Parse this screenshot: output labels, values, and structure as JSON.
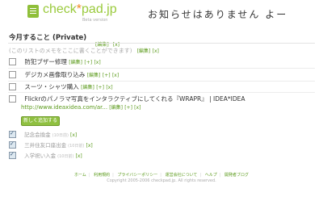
{
  "header": {
    "logo_text_main": "check",
    "logo_text_dot": "*",
    "logo_text_tail": "pad.jp",
    "logo_sub": "Beta version",
    "notice": "お知らせはありません よー"
  },
  "list": {
    "title": "今月すること (Private)",
    "title_edit": "[編集]",
    "title_delete": "[x]",
    "memo_placeholder": "(このリストのメモをここに書くことができます)",
    "memo_edit": "[編集]",
    "memo_delete": "[x]"
  },
  "items": [
    {
      "label": "防犯ブザー修理",
      "edit": "[編集]",
      "plus": "[+]",
      "delete": "[x]"
    },
    {
      "label": "デジカメ画像取り込み",
      "edit": "[編集]",
      "plus": "[+]",
      "delete": "[x]"
    },
    {
      "label": "スーツ・シャツ購入",
      "edit": "[編集]",
      "plus": "[+]",
      "delete": "[x]"
    },
    {
      "label": "Flickrのパノラマ写真をインタラクティブにしてくれる『WRAPR』 | IDEA*IDEA",
      "url": "http://www.ideaxidea.com/ar...",
      "edit": "[編集]",
      "plus": "[+]",
      "delete": "[x]"
    }
  ],
  "add_button": "新しく追加する",
  "done_items": [
    {
      "label": "記念会換金",
      "date": "(10日前)",
      "delete": "[x]"
    },
    {
      "label": "三井住友口座出金",
      "date": "(10日前)",
      "delete": "[x]"
    },
    {
      "label": "入学祝い入金",
      "date": "(10日前)",
      "delete": "[x]"
    }
  ],
  "footer": {
    "links": [
      "ホーム",
      "利用規約",
      "プライバシーポリシー",
      "運営会社について",
      "ヘルプ",
      "開発者ブログ"
    ],
    "copyright": "Copyright 2005-2006 checkpad.jp. All rights reserved."
  },
  "colors": {
    "accent": "#9aca3c",
    "link": "#5a9a1a",
    "button": "#8fc040"
  }
}
